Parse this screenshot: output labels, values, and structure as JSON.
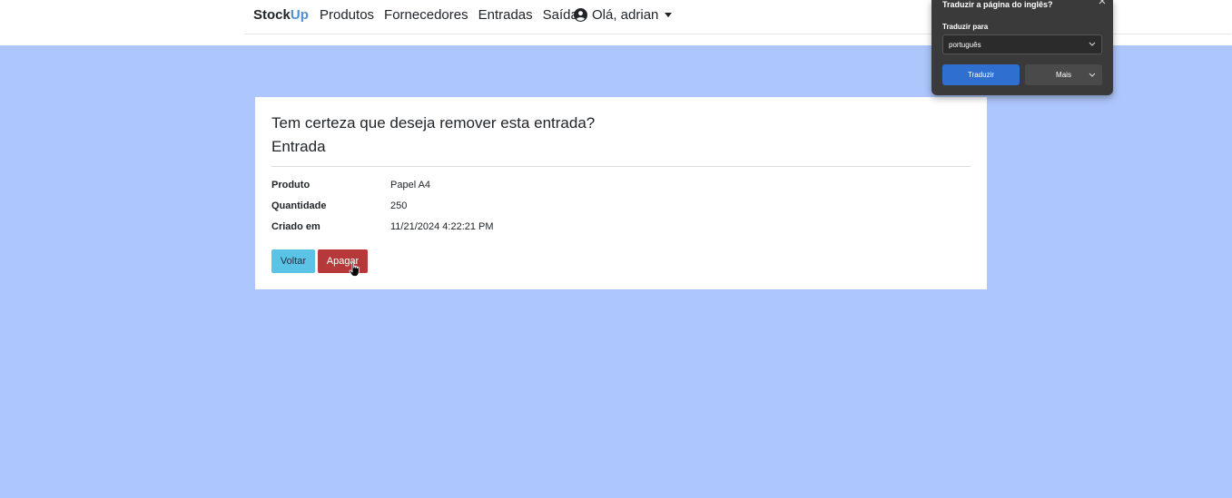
{
  "navbar": {
    "brand_stock": "Stock",
    "brand_up": "Up",
    "links": [
      "Produtos",
      "Fornecedores",
      "Entradas",
      "Saídas"
    ],
    "user_greeting": "Olá, adrian"
  },
  "card": {
    "question": "Tem certeza que deseja remover esta entrada?",
    "subtitle": "Entrada",
    "fields": [
      {
        "label": "Produto",
        "value": "Papel A4"
      },
      {
        "label": "Quantidade",
        "value": "250"
      },
      {
        "label": "Criado em",
        "value": "11/21/2024 4:22:21 PM"
      }
    ],
    "back_label": "Voltar",
    "delete_label": "Apagar"
  },
  "translate_popup": {
    "title": "Traduzir a página do inglês?",
    "to_label": "Traduzir para",
    "language": "português",
    "translate_label": "Traduzir",
    "more_label": "Mais"
  },
  "colors": {
    "background": "#adc6fc",
    "brand_accent": "#4f8fd6",
    "back_button": "#5bc4e6",
    "delete_button": "#b5393a",
    "translate_button": "#2f6fd0"
  }
}
